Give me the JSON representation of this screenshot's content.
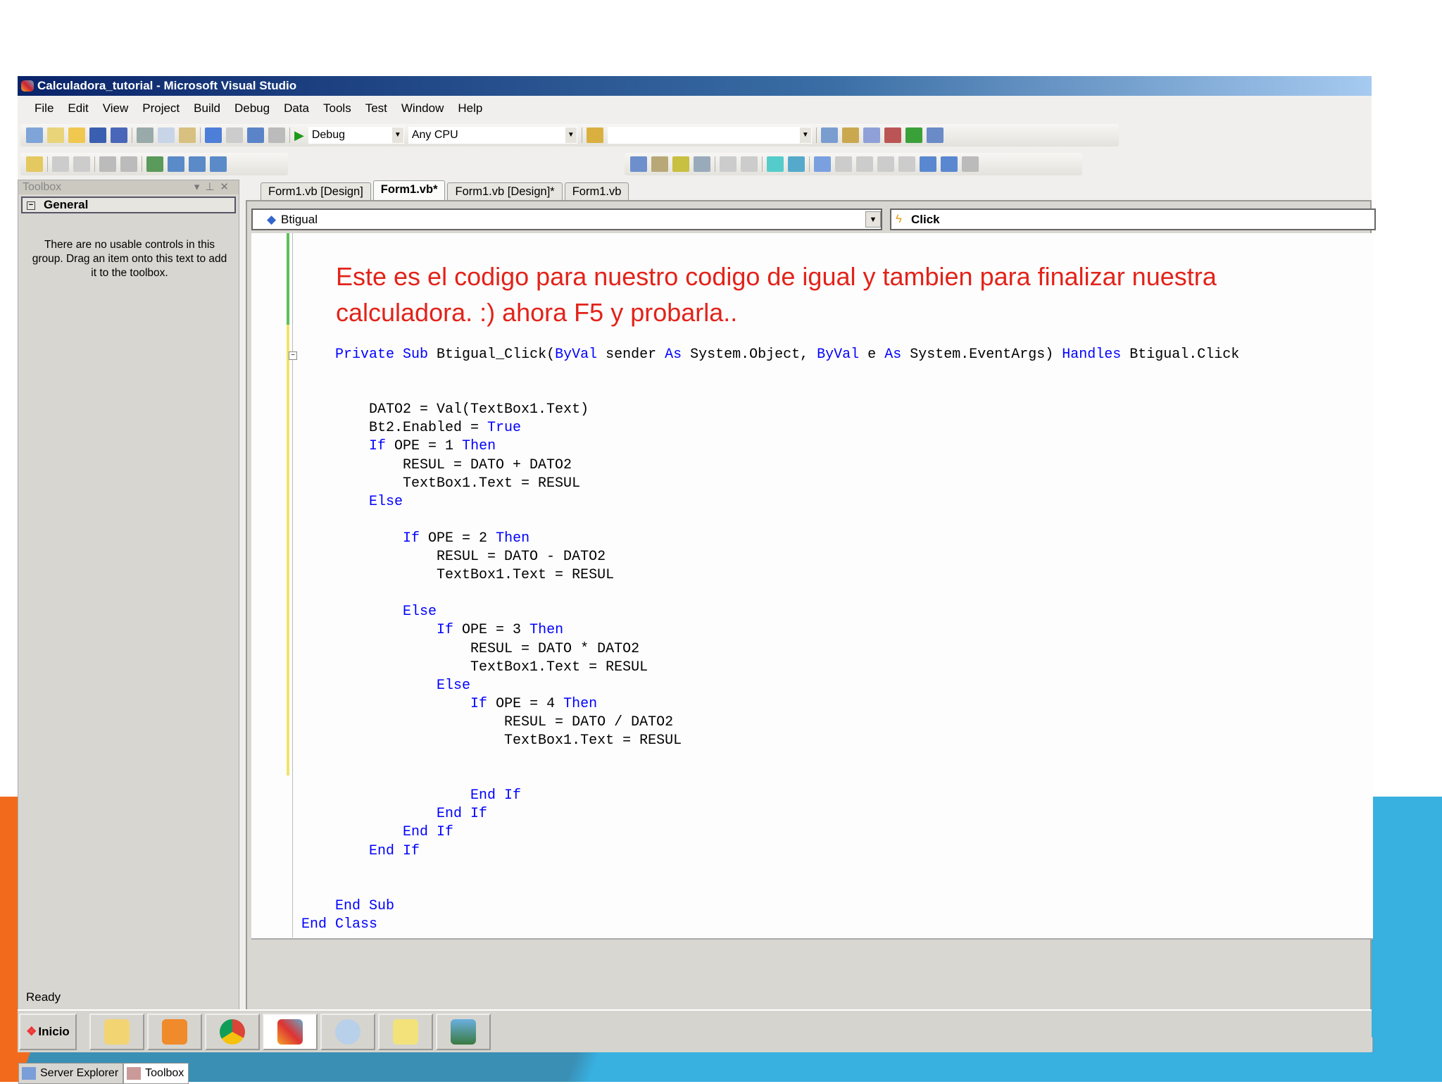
{
  "window": {
    "title": "Calculadora_tutorial - Microsoft Visual Studio"
  },
  "menu": [
    "File",
    "Edit",
    "View",
    "Project",
    "Build",
    "Debug",
    "Data",
    "Tools",
    "Test",
    "Window",
    "Help"
  ],
  "toolbar": {
    "config": "Debug",
    "platform": "Any CPU",
    "find": ""
  },
  "toolbox": {
    "title": "Toolbox",
    "group": "General",
    "message": "There are no usable controls in this group. Drag an item onto this text to add it to the toolbox.",
    "bottom_tabs": [
      "Server Explorer",
      "Toolbox"
    ]
  },
  "doc_tabs": [
    "Form1.vb [Design]",
    "Form1.vb*",
    "Form1.vb [Design]*",
    "Form1.vb"
  ],
  "editor": {
    "object": "Btigual",
    "event": "Click",
    "note": "Este es el codigo para nuestro codigo de igual y tambien para finalizar nuestra calculadora. :) ahora F5 y probarla..",
    "lines": [
      [
        {
          "t": "    "
        },
        {
          "t": "Private Sub",
          "k": 1
        },
        {
          "t": " Btigual_Click("
        },
        {
          "t": "ByVal",
          "k": 1
        },
        {
          "t": " sender "
        },
        {
          "t": "As",
          "k": 1
        },
        {
          "t": " System.Object, "
        },
        {
          "t": "ByVal",
          "k": 1
        },
        {
          "t": " e "
        },
        {
          "t": "As",
          "k": 1
        },
        {
          "t": " System.EventArgs) "
        },
        {
          "t": "Handles",
          "k": 1
        },
        {
          "t": " Btigual.Click"
        }
      ],
      [],
      [],
      [
        {
          "t": "        DATO2 = Val(TextBox1.Text)"
        }
      ],
      [
        {
          "t": "        Bt2.Enabled = "
        },
        {
          "t": "True",
          "k": 1
        }
      ],
      [
        {
          "t": "        "
        },
        {
          "t": "If",
          "k": 1
        },
        {
          "t": " OPE = 1 "
        },
        {
          "t": "Then",
          "k": 1
        }
      ],
      [
        {
          "t": "            RESUL = DATO + DATO2"
        }
      ],
      [
        {
          "t": "            TextBox1.Text = RESUL"
        }
      ],
      [
        {
          "t": "        "
        },
        {
          "t": "Else",
          "k": 1
        }
      ],
      [],
      [
        {
          "t": "            "
        },
        {
          "t": "If",
          "k": 1
        },
        {
          "t": " OPE = 2 "
        },
        {
          "t": "Then",
          "k": 1
        }
      ],
      [
        {
          "t": "                RESUL = DATO - DATO2"
        }
      ],
      [
        {
          "t": "                TextBox1.Text = RESUL"
        }
      ],
      [],
      [
        {
          "t": "            "
        },
        {
          "t": "Else",
          "k": 1
        }
      ],
      [
        {
          "t": "                "
        },
        {
          "t": "If",
          "k": 1
        },
        {
          "t": " OPE = 3 "
        },
        {
          "t": "Then",
          "k": 1
        }
      ],
      [
        {
          "t": "                    RESUL = DATO * DATO2"
        }
      ],
      [
        {
          "t": "                    TextBox1.Text = RESUL"
        }
      ],
      [
        {
          "t": "                "
        },
        {
          "t": "Else",
          "k": 1
        }
      ],
      [
        {
          "t": "                    "
        },
        {
          "t": "If",
          "k": 1
        },
        {
          "t": " OPE = 4 "
        },
        {
          "t": "Then",
          "k": 1
        }
      ],
      [
        {
          "t": "                        RESUL = DATO / DATO2"
        }
      ],
      [
        {
          "t": "                        TextBox1.Text = RESUL"
        }
      ],
      [],
      [],
      [
        {
          "t": "                    "
        },
        {
          "t": "End If",
          "k": 1
        }
      ],
      [
        {
          "t": "                "
        },
        {
          "t": "End If",
          "k": 1
        }
      ],
      [
        {
          "t": "            "
        },
        {
          "t": "End If",
          "k": 1
        }
      ],
      [
        {
          "t": "        "
        },
        {
          "t": "End If",
          "k": 1
        }
      ],
      [],
      [],
      [
        {
          "t": "    "
        },
        {
          "t": "End Sub",
          "k": 1
        }
      ],
      [
        {
          "t": "End Class",
          "k": 1
        }
      ]
    ]
  },
  "status": "Ready",
  "taskbar": {
    "start": "Inicio",
    "apps": [
      "explorer",
      "media-player",
      "chrome",
      "visual-studio",
      "paint",
      "sticky-notes",
      "photo-viewer"
    ]
  },
  "colors": {
    "keyword": "#0000ff",
    "note": "#e2231a",
    "title_start": "#0a246a"
  }
}
